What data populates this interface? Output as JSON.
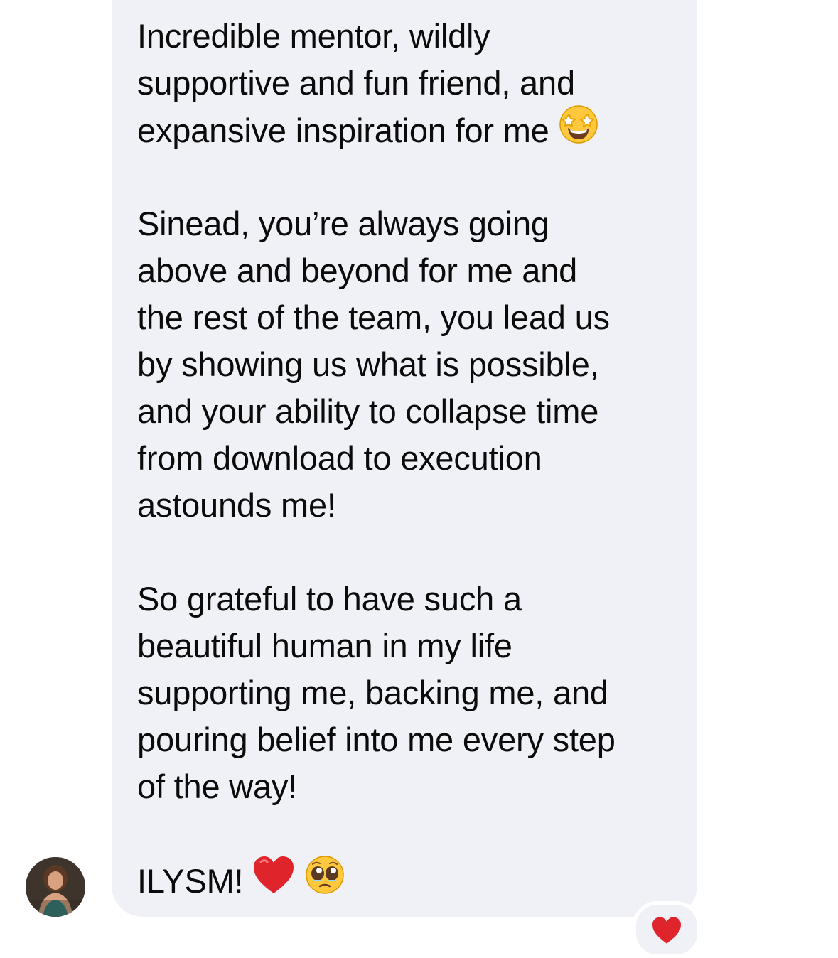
{
  "message": {
    "paragraph_1": [
      "Incredible mentor, wildly",
      "supportive and fun friend, and",
      "expansive inspiration for me"
    ],
    "paragraph_2": [
      "Sinead, you’re always going",
      "above and beyond for me and",
      "the rest of the team, you lead us",
      "by showing us what is possible,",
      "and your ability to collapse time",
      "from download to execution",
      "astounds me!"
    ],
    "paragraph_3": [
      "So grateful to have such a",
      "beautiful human in my life",
      "supporting me, backing me, and",
      "pouring belief into me every step",
      "of the way!"
    ],
    "closing": "ILYSM!",
    "emojis": [
      "star-struck-emoji",
      "red-heart-emoji",
      "pleading-face-emoji"
    ]
  },
  "reaction": {
    "icon": "red-heart-icon"
  },
  "sender": {
    "avatar_icon": "profile-photo"
  },
  "colors": {
    "bubble_background": "#f0f1f6",
    "text": "#0b0b0b",
    "heart": "#e0242b",
    "emoji_yellow": "#ffc83d"
  }
}
